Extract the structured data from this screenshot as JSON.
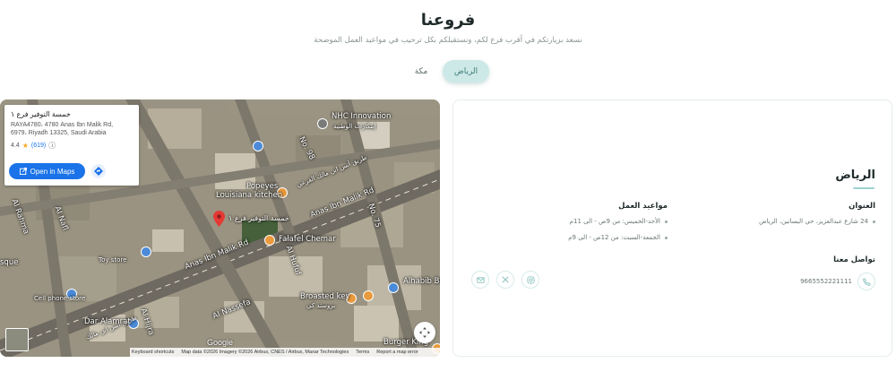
{
  "header": {
    "title": "فروعنا",
    "subtitle": "نسعد بزيارتكم في أقرب فرع لكم، ونستقبلكم بكل ترحيب في مواعيد العمل الموضحة"
  },
  "tabs": [
    {
      "label": "الرياض",
      "active": true
    },
    {
      "label": "مكة",
      "active": false
    }
  ],
  "map": {
    "info_card": {
      "name": "خمسة التوفير فرع ١",
      "address_line1": "RAYA4780، 4780 Anas Ibn Malik Rd,",
      "address_line2": "6979، Riyadh 13325, Saudi Arabia",
      "rating": "4.4",
      "review_count": "(619)",
      "open_button": "Open in Maps"
    },
    "labels": {
      "nhc": "NHC Innovation",
      "nhc_ar": "إبتكارات الوطنية",
      "no98": "No. 98",
      "anas_ibn_malik": "Anas Ibn Malik Rd",
      "anas_ibn_malik_2": "Anas Ibn Malik Rd",
      "anas_ar": "طريق أنس ابن مالك الفرعي",
      "anas_ar2": "طريق أنس ابن مالك",
      "popeyes": "Popeyes",
      "louisiana": "Louisiana kitchen",
      "no75": "No. 75",
      "store_pin": "خمسة التوفير فرع ١",
      "falafel": "Falafel Chemar",
      "alhufuf": "Al Hufuf",
      "alhufuf_ar": "الهفوف",
      "alhabib": "Alhabib Be",
      "broasted": "Broasted key",
      "broasted_ar": "بروستد كي",
      "al_rahma": "Al Rahma",
      "al_nafl": "Al Nafl",
      "al_nassefa": "Al Nassefa",
      "dar_almarat": "Dar Alamrat",
      "al_hijra": "Al Hijra",
      "burger_king": "Burger King",
      "cell_store": "Cell phone store",
      "sque": "sque",
      "toy_store": "Toy store"
    },
    "footer": {
      "shortcuts": "Keyboard shortcuts",
      "map_data": "Map data ©2026 Imagery ©2026 Airbus, CNES / Airbus, Maxar Technologies",
      "terms": "Terms",
      "report": "Report a map error"
    },
    "google": "Google"
  },
  "details": {
    "city": "الرياض",
    "address_heading": "العنوان",
    "address_text": "24 شارع عبدالعزيز، حي البساتين، الرياض",
    "hours_heading": "مواعيد العمل",
    "hours": [
      "الأحد-الخميس: من 9ص - الى 11م",
      "الجمعة-السبت: من 12ص - الى 9م"
    ],
    "contact_heading": "تواصل معنا",
    "phone": "9665552221111",
    "socials": [
      "instagram-icon",
      "x-icon",
      "email-icon"
    ]
  },
  "colors": {
    "accent": "#cde9e7",
    "accent_text": "#3d7d79",
    "underline": "#9fd3cf"
  }
}
